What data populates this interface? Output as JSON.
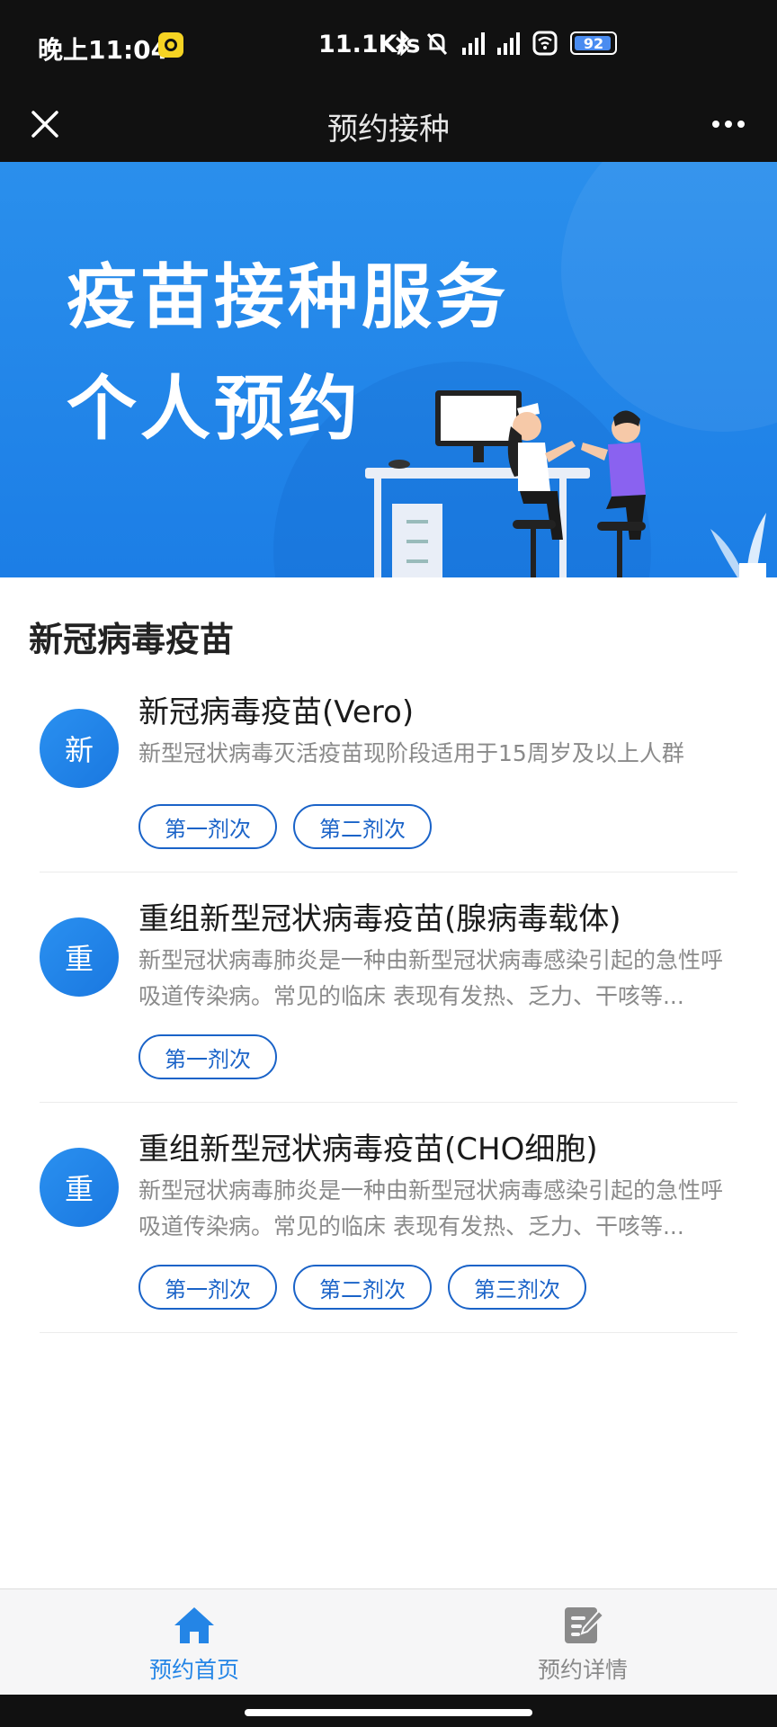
{
  "status_bar": {
    "time": "晚上11:04",
    "net_speed": "11.1K/s",
    "battery": "92"
  },
  "nav": {
    "title": "预约接种"
  },
  "banner": {
    "title": "疫苗接种服务",
    "subtitle": "个人预约"
  },
  "section": {
    "title": "新冠病毒疫苗"
  },
  "vaccines": [
    {
      "avatar": "新",
      "name": "新冠病毒疫苗(Vero)",
      "desc": "新型冠状病毒灭活疫苗现阶段适用于15周岁及以上人群",
      "doses": [
        "第一剂次",
        "第二剂次"
      ]
    },
    {
      "avatar": "重",
      "name": "重组新型冠状病毒疫苗(腺病毒载体)",
      "desc": "新型冠状病毒肺炎是一种由新型冠状病毒感染引起的急性呼吸道传染病。常见的临床 表现有发热、乏力、干咳等...",
      "doses": [
        "第一剂次"
      ]
    },
    {
      "avatar": "重",
      "name": "重组新型冠状病毒疫苗(CHO细胞)",
      "desc": "新型冠状病毒肺炎是一种由新型冠状病毒感染引起的急性呼吸道传染病。常见的临床 表现有发热、乏力、干咳等...",
      "doses": [
        "第一剂次",
        "第二剂次",
        "第三剂次"
      ]
    }
  ],
  "tabbar": {
    "home_label": "预约首页",
    "detail_label": "预约详情"
  },
  "colors": {
    "accent": "#2485e6",
    "dose_border": "#1a63c8",
    "banner_blue": "#1c7ee6"
  }
}
